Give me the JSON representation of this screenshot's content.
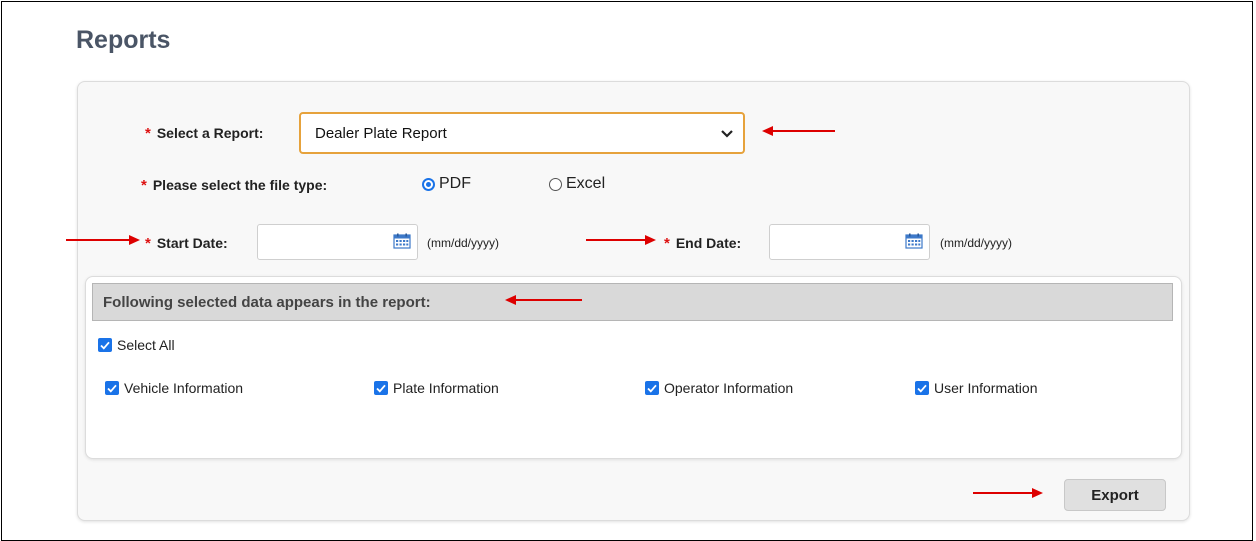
{
  "page": {
    "title": "Reports"
  },
  "form": {
    "report_label": "Select a Report:",
    "report_value": "Dealer Plate Report",
    "filetype_label": "Please select the file type:",
    "filetype_options": [
      "PDF",
      "Excel"
    ],
    "filetype_selected": "PDF",
    "start_label": "Start Date:",
    "start_value": "",
    "end_label": "End Date:",
    "end_value": "",
    "date_format": "(mm/dd/yyyy)",
    "required_mark": "*"
  },
  "section": {
    "title": "Following selected data appears in the report:",
    "select_all": "Select All",
    "options": [
      "Vehicle Information",
      "Plate Information",
      "Operator Information",
      "User Information"
    ]
  },
  "actions": {
    "export": "Export"
  },
  "icons": {
    "calendar": "calendar-icon",
    "check": "checkbox-checked-icon",
    "chevron": "chevron-down-icon",
    "annotation_arrow": "red-arrow-icon"
  },
  "colors": {
    "title": "#4a5566",
    "required": "#dd1111",
    "select_border": "#e6a23c",
    "accent": "#1a73e8",
    "annotation": "#dd0000"
  }
}
